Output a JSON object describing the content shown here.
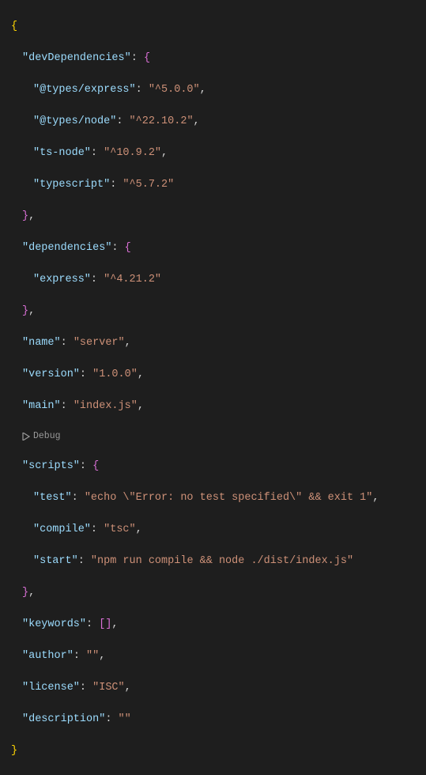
{
  "codelens": {
    "debug": "Debug"
  },
  "json": {
    "devDependencies_key": "\"devDependencies\"",
    "devDeps": {
      "types_express_k": "\"@types/express\"",
      "types_express_v": "\"^5.0.0\"",
      "types_node_k": "\"@types/node\"",
      "types_node_v": "\"^22.10.2\"",
      "ts_node_k": "\"ts-node\"",
      "ts_node_v": "\"^10.9.2\"",
      "typescript_k": "\"typescript\"",
      "typescript_v": "\"^5.7.2\""
    },
    "dependencies_key": "\"dependencies\"",
    "deps": {
      "express_k": "\"express\"",
      "express_v": "\"^4.21.2\""
    },
    "name_k": "\"name\"",
    "name_v": "\"server\"",
    "version_k": "\"version\"",
    "version_v": "\"1.0.0\"",
    "main_k": "\"main\"",
    "main_v": "\"index.js\"",
    "scripts_key": "\"scripts\"",
    "scripts": {
      "test_k": "\"test\"",
      "test_v": "\"echo \\\"Error: no test specified\\\" && exit 1\"",
      "compile_k": "\"compile\"",
      "compile_v": "\"tsc\"",
      "start_k": "\"start\"",
      "start_v": "\"npm run compile && node ./dist/index.js\""
    },
    "keywords_k": "\"keywords\"",
    "author_k": "\"author\"",
    "author_v": "\"\"",
    "license_k": "\"license\"",
    "license_v": "\"ISC\"",
    "description_k": "\"description\"",
    "description_v": "\"\""
  }
}
